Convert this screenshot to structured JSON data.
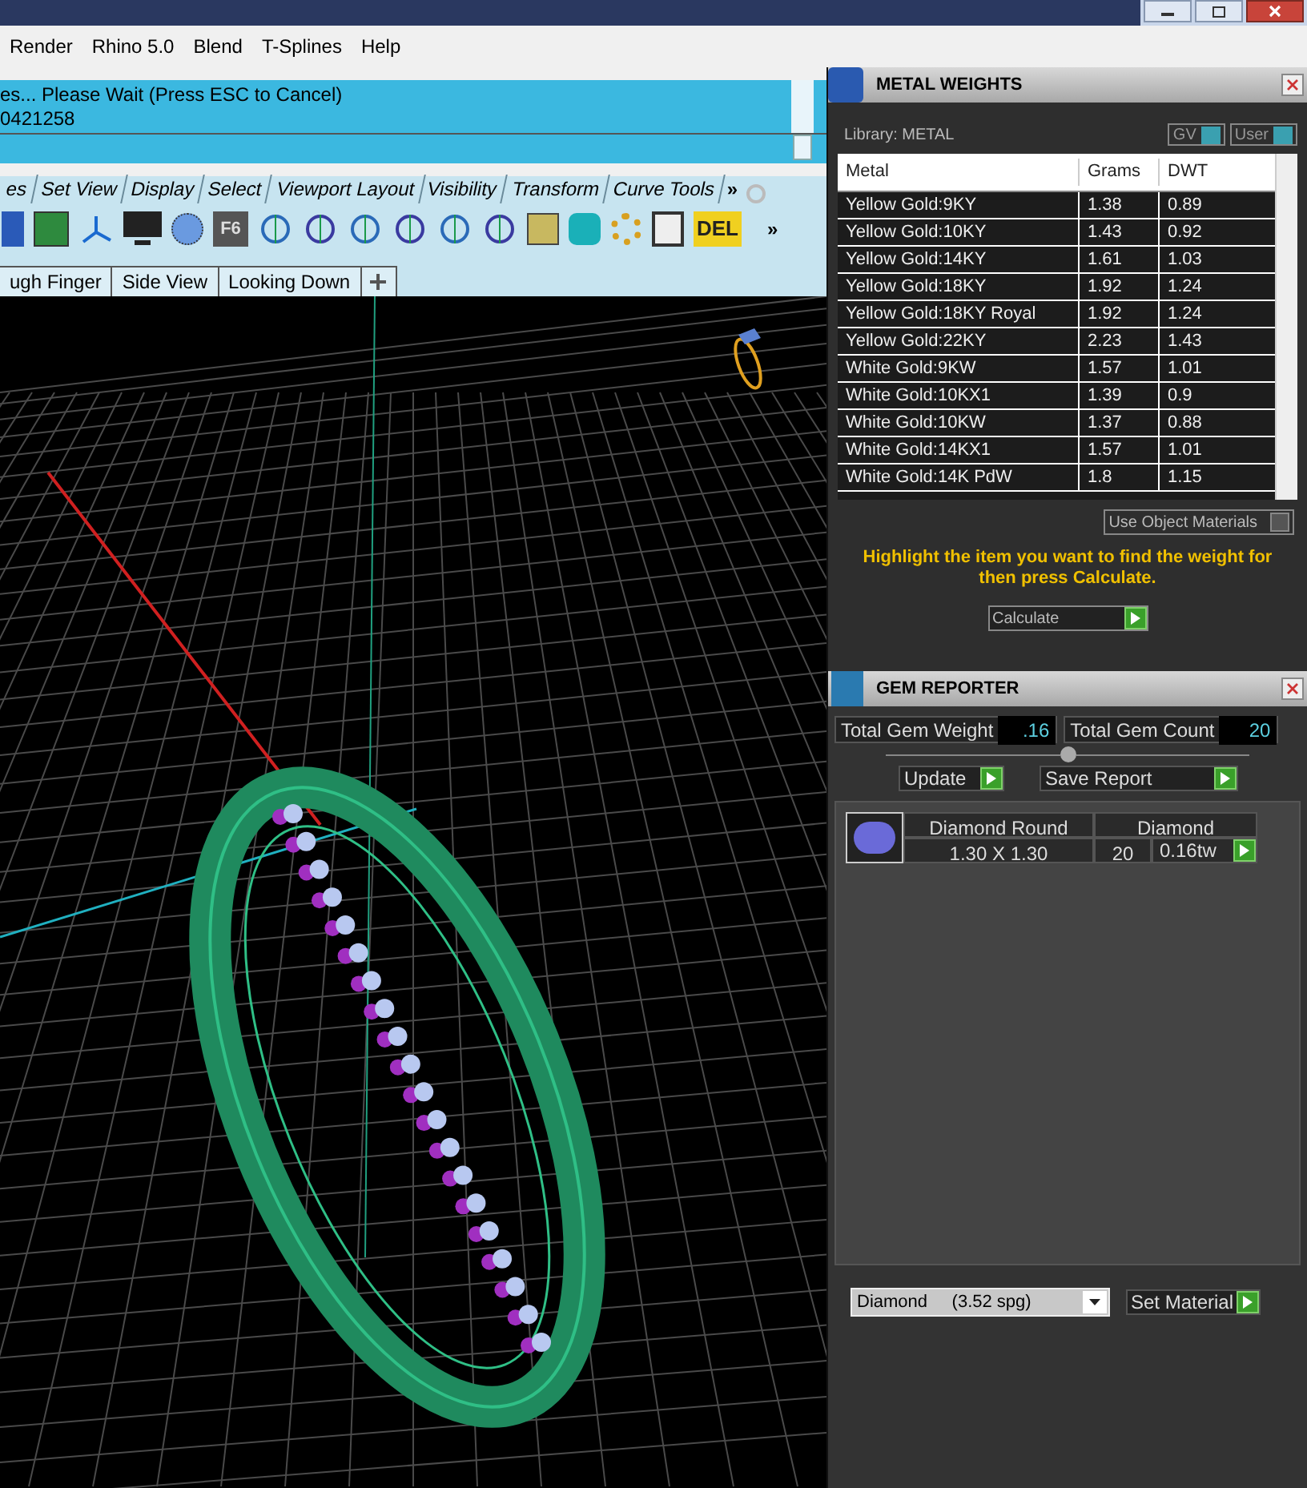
{
  "menu": [
    "Render",
    "Rhino 5.0",
    "Blend",
    "T-Splines",
    "Help"
  ],
  "command_history": [
    "es... Please Wait (Press ESC to Cancel)",
    "0421258"
  ],
  "toolbar_tabs": [
    "es",
    "Set View",
    "Display",
    "Select",
    "Viewport Layout",
    "Visibility",
    "Transform",
    "Curve Tools"
  ],
  "toolbar_tabs_overflow": "»",
  "toolbar": {
    "f6_label": "F6",
    "del_label": "DEL",
    "overflow": "»"
  },
  "viewport_tabs": [
    "ugh Finger",
    "Side View",
    "Looking Down"
  ],
  "metal_weights": {
    "title": "METAL WEIGHTS",
    "library": "Library: METAL",
    "toggles": [
      {
        "label": "GV",
        "on": true
      },
      {
        "label": "User",
        "on": true
      }
    ],
    "columns": [
      "Metal",
      "Grams",
      "DWT"
    ],
    "rows": [
      [
        "Yellow Gold:9KY",
        "1.38",
        "0.89"
      ],
      [
        "Yellow Gold:10KY",
        "1.43",
        "0.92"
      ],
      [
        "Yellow Gold:14KY",
        "1.61",
        "1.03"
      ],
      [
        "Yellow Gold:18KY",
        "1.92",
        "1.24"
      ],
      [
        "Yellow Gold:18KY Royal",
        "1.92",
        "1.24"
      ],
      [
        "Yellow Gold:22KY",
        "2.23",
        "1.43"
      ],
      [
        "White Gold:9KW",
        "1.57",
        "1.01"
      ],
      [
        "White Gold:10KX1",
        "1.39",
        "0.9"
      ],
      [
        "White Gold:10KW",
        "1.37",
        "0.88"
      ],
      [
        "White Gold:14KX1",
        "1.57",
        "1.01"
      ],
      [
        "White Gold:14K PdW",
        "1.8",
        "1.15"
      ]
    ],
    "use_object_materials": {
      "label": "Use Object Materials",
      "checked": false
    },
    "hint": "Highlight the item you want to find the weight for then press Calculate.",
    "calculate": "Calculate"
  },
  "gem_reporter": {
    "title": "GEM REPORTER",
    "total_weight": {
      "label": "Total Gem Weight",
      "value": ".16"
    },
    "total_count": {
      "label": "Total Gem Count",
      "value": "20"
    },
    "buttons": [
      "Update",
      "Save Report"
    ],
    "gems": [
      {
        "shape": "Diamond Round",
        "material": "Diamond",
        "size": "1.30 X 1.30",
        "count": "20",
        "weight": "0.16tw"
      }
    ],
    "material_select": "Diamond     (3.52 spg)",
    "set_material": "Set Material"
  }
}
